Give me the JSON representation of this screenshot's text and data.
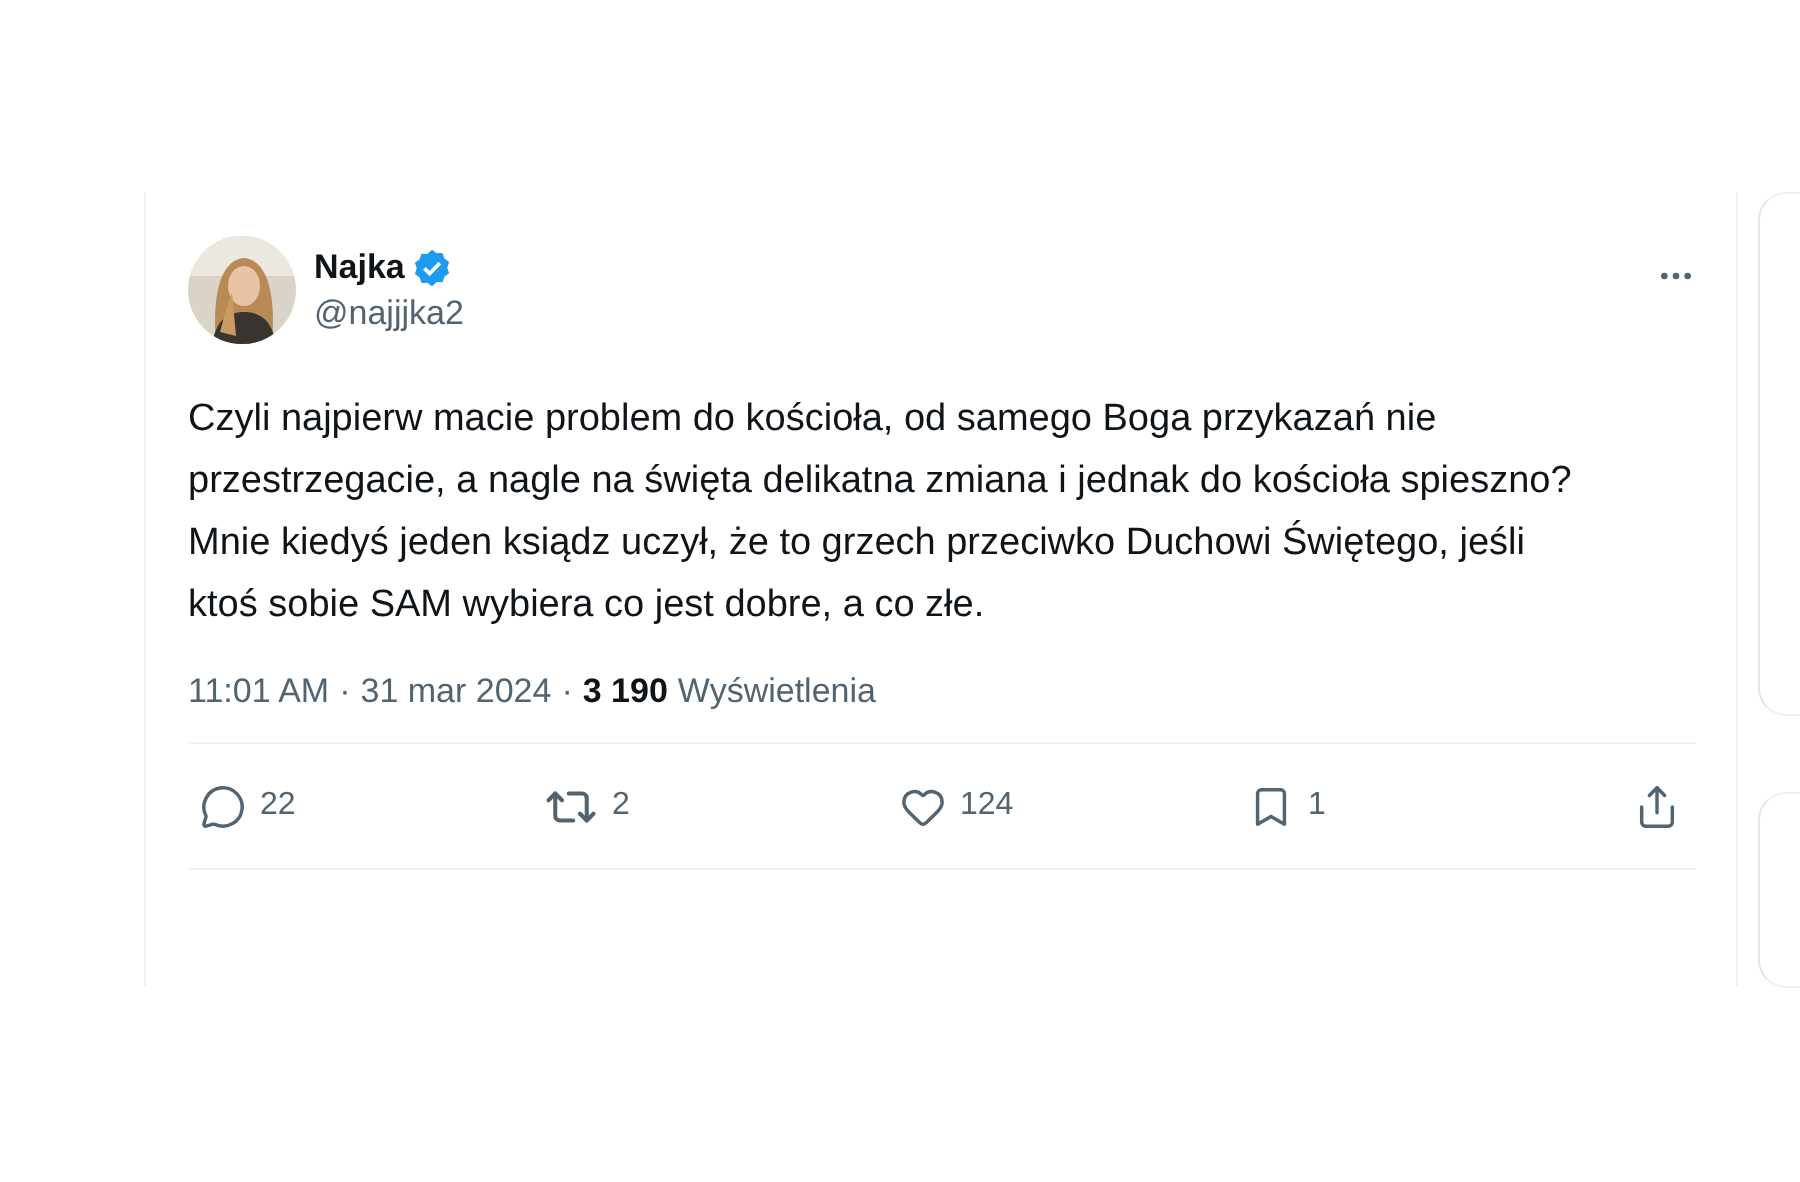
{
  "tweet": {
    "author": {
      "name": "Najka",
      "verified": true,
      "handle": "@najjjka2"
    },
    "text": "Czyli najpierw macie problem do kościoła, od samego Boga przykazań nie przestrzegacie, a nagle na święta delikatna zmiana i jednak do kościoła spieszno? Mnie kiedyś jeden ksiądz uczył, że to grzech przeciwko Duchowi Świętego, jeśli ktoś sobie SAM wybiera co jest dobre, a co złe.",
    "time": "11:01 AM",
    "separator": "·",
    "date": "31 mar 2024",
    "views_count": "3 190",
    "views_label": "Wyświetlenia",
    "actions": [
      {
        "kind": "reply",
        "count": "22"
      },
      {
        "kind": "repost",
        "count": "2"
      },
      {
        "kind": "like",
        "count": "124"
      },
      {
        "kind": "bookmark",
        "count": "1"
      },
      {
        "kind": "share"
      }
    ]
  }
}
